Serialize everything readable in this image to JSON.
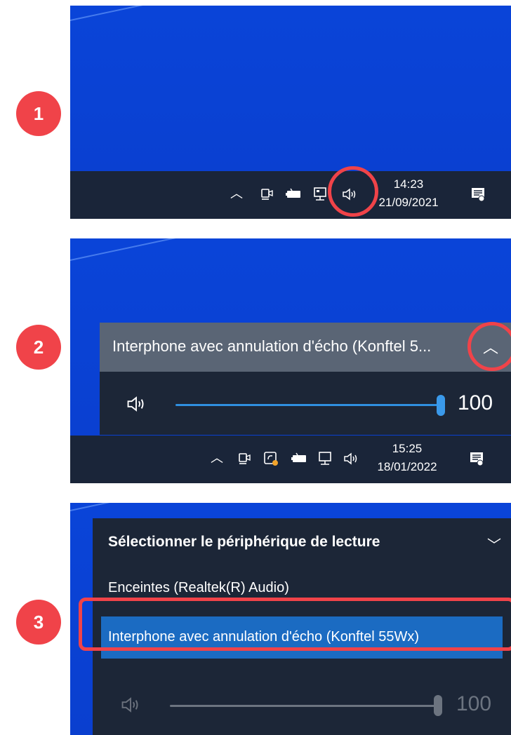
{
  "steps": [
    "1",
    "2",
    "3"
  ],
  "colors": {
    "badge": "#f04349",
    "desktop_blue": "#0a44d8",
    "taskbar": "#1a2539",
    "flyout_header": "#5a6575",
    "flyout_body": "#1c2637",
    "slider_accent": "#2f8fe0",
    "selected_item": "#1b6bc2",
    "highlight": "#f04349"
  },
  "panel1": {
    "tray_icons": [
      "chevron-up-icon",
      "meeting-camera-icon",
      "battery-icon",
      "network-icon",
      "speaker-icon"
    ],
    "time": "14:23",
    "date": "21/09/2021"
  },
  "panel2": {
    "device_name": "Interphone avec annulation d'écho (Konftel 5...",
    "volume": 100,
    "volume_label": "100",
    "tray_icons": [
      "chevron-up-icon",
      "meeting-camera-icon",
      "sync-icon",
      "battery-icon",
      "network-icon",
      "speaker-icon"
    ],
    "time": "15:25",
    "date": "18/01/2022"
  },
  "panel3": {
    "title": "Sélectionner le périphérique de lecture",
    "devices": [
      "Enceintes (Realtek(R) Audio)",
      "Interphone avec annulation d'écho (Konftel 55Wx)"
    ],
    "selected_index": 1,
    "volume": 100,
    "volume_label": "100"
  }
}
